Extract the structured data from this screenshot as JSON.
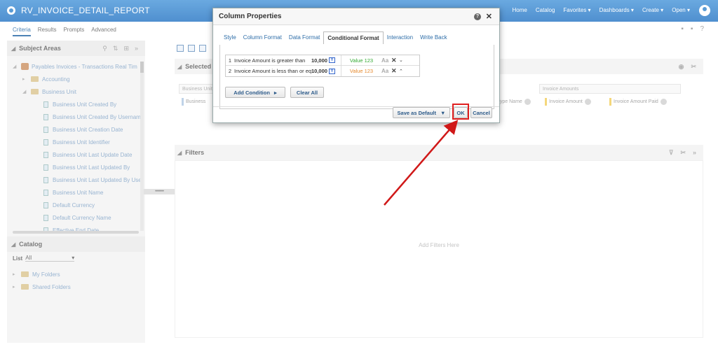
{
  "app": {
    "title": "RV_INVOICE_DETAIL_REPORT"
  },
  "topnav": {
    "home": "Home",
    "catalog": "Catalog",
    "favorites": "Favorites ▾",
    "dashboards": "Dashboards ▾",
    "create": "Create ▾",
    "open": "Open ▾"
  },
  "subtabs": {
    "criteria": "Criteria",
    "results": "Results",
    "prompts": "Prompts",
    "advanced": "Advanced"
  },
  "subject_areas": {
    "header": "Subject Areas",
    "items": [
      "Payables Invoices - Transactions Real Tim",
      "Accounting",
      "Business Unit",
      "Business Unit Created By",
      "Business Unit Created By Usernam",
      "Business Unit Creation Date",
      "Business Unit Identifier",
      "Business Unit Last Update Date",
      "Business Unit Last Updated By",
      "Business Unit Last Updated By Use",
      "Business Unit Name",
      "Default Currency",
      "Default Currency Name",
      "Effective End Date"
    ]
  },
  "catalog": {
    "header": "Catalog",
    "list_label": "List",
    "list_value": "All",
    "items": [
      "My Folders",
      "Shared Folders"
    ]
  },
  "selected_columns": {
    "header": "Selected C",
    "group_left": "Business Unit",
    "group_right": "Invoice Amounts",
    "chip_left": "Business",
    "chips": [
      "Type Name",
      "Invoice Amount",
      "Invoice Amount Paid"
    ]
  },
  "filters": {
    "header": "Filters",
    "hint": "Add Filters Here"
  },
  "dialog": {
    "title": "Column Properties",
    "tabs": [
      "Style",
      "Column Format",
      "Data Format",
      "Conditional Format",
      "Interaction",
      "Write Back"
    ],
    "active_tab": "Conditional Format",
    "conditions": [
      {
        "num": "1",
        "text": "Invoice Amount is greater than",
        "value": "10,000",
        "format": "Value 123",
        "color": "#33aa33"
      },
      {
        "num": "2",
        "text": "Invoice Amount is less than or equa",
        "value": "10,000",
        "format": "Value 123",
        "color": "#e68a2e"
      }
    ],
    "add_condition": "Add Condition",
    "clear_all": "Clear All",
    "save_default": "Save as Default",
    "ok": "OK",
    "cancel": "Cancel"
  },
  "splitter": "•••••••••••",
  "colors": {
    "topbar": "#5a9bd5",
    "highlight": "#e02020"
  }
}
